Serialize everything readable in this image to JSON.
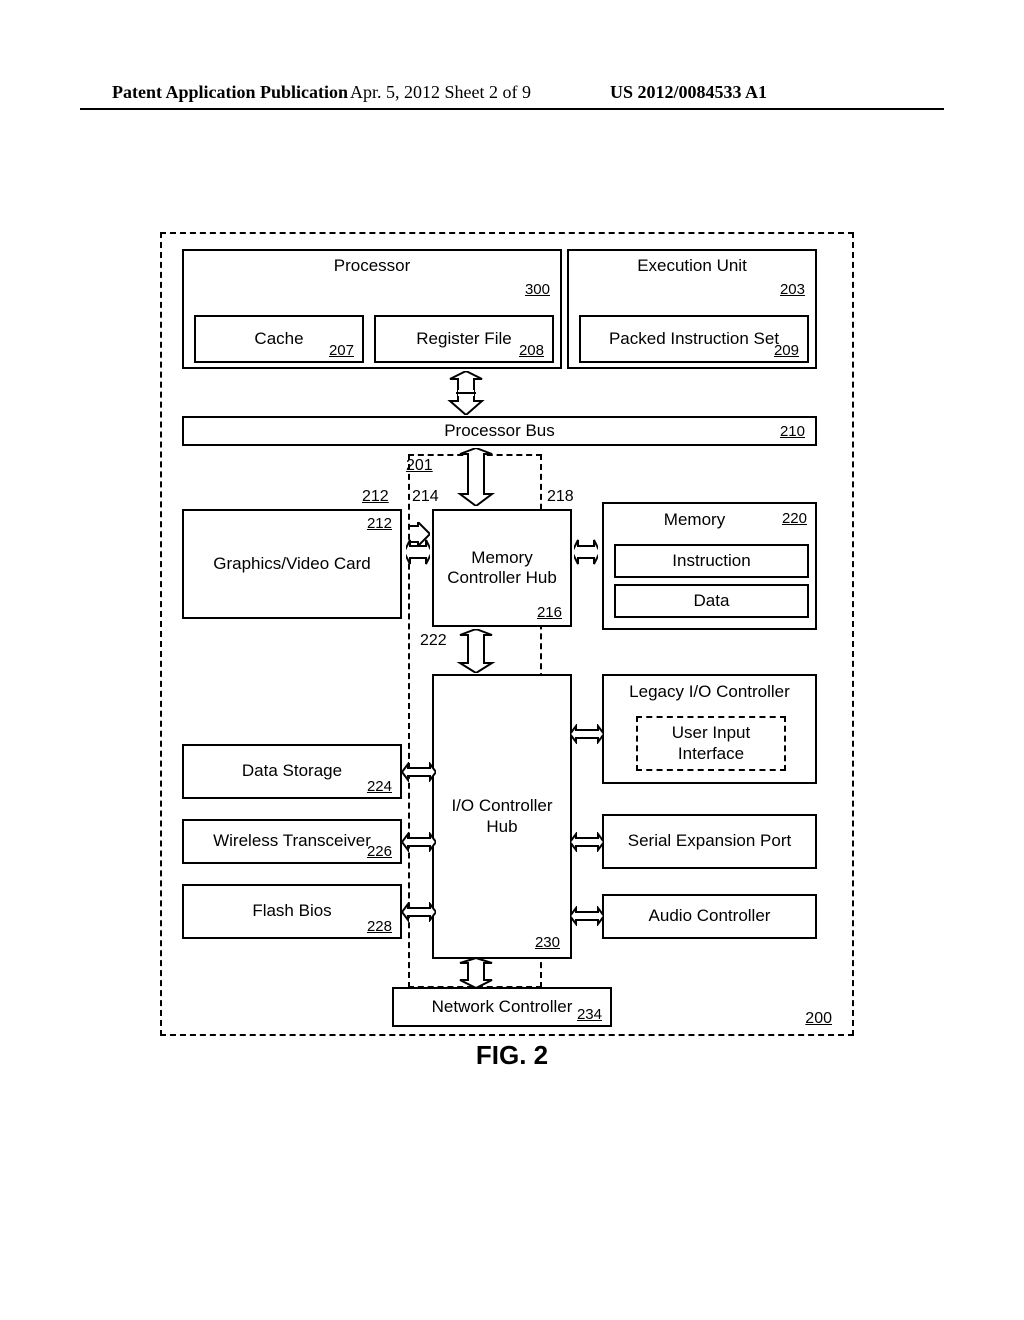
{
  "header": {
    "left": "Patent Application Publication",
    "mid": "Apr. 5, 2012  Sheet 2 of 9",
    "right": "US 2012/0084533 A1"
  },
  "figure": {
    "caption": "FIG. 2",
    "system_ref": "200",
    "labels": {
      "ref201": "201",
      "ref212": "212",
      "ref214": "214",
      "ref218": "218",
      "ref222": "222"
    }
  },
  "blocks": {
    "processor": {
      "label": "Processor",
      "ref": "300"
    },
    "cache": {
      "label": "Cache",
      "ref": "207"
    },
    "regfile": {
      "label": "Register File",
      "ref": "208"
    },
    "exec": {
      "label": "Execution Unit",
      "ref": "203"
    },
    "pis": {
      "label": "Packed Instruction Set",
      "ref": "209"
    },
    "pbus": {
      "label": "Processor Bus",
      "ref": "210"
    },
    "gfx": {
      "label": "Graphics/Video Card",
      "ref": "212"
    },
    "mch": {
      "label": "Memory Controller Hub",
      "ref": "216"
    },
    "mem": {
      "label": "Memory",
      "ref": "220"
    },
    "instr": {
      "label": "Instruction"
    },
    "data": {
      "label": "Data"
    },
    "ich": {
      "label": "I/O Controller Hub",
      "ref": "230"
    },
    "dstore": {
      "label": "Data Storage",
      "ref": "224"
    },
    "wtx": {
      "label": "Wireless Transceiver",
      "ref": "226"
    },
    "fbios": {
      "label": "Flash Bios",
      "ref": "228"
    },
    "legacy": {
      "label": "Legacy I/O Controller"
    },
    "usrin": {
      "label": "User Input Interface"
    },
    "sep": {
      "label": "Serial Expansion Port"
    },
    "audio": {
      "label": "Audio Controller"
    },
    "netctrl": {
      "label": "Network Controller",
      "ref": "234"
    }
  }
}
